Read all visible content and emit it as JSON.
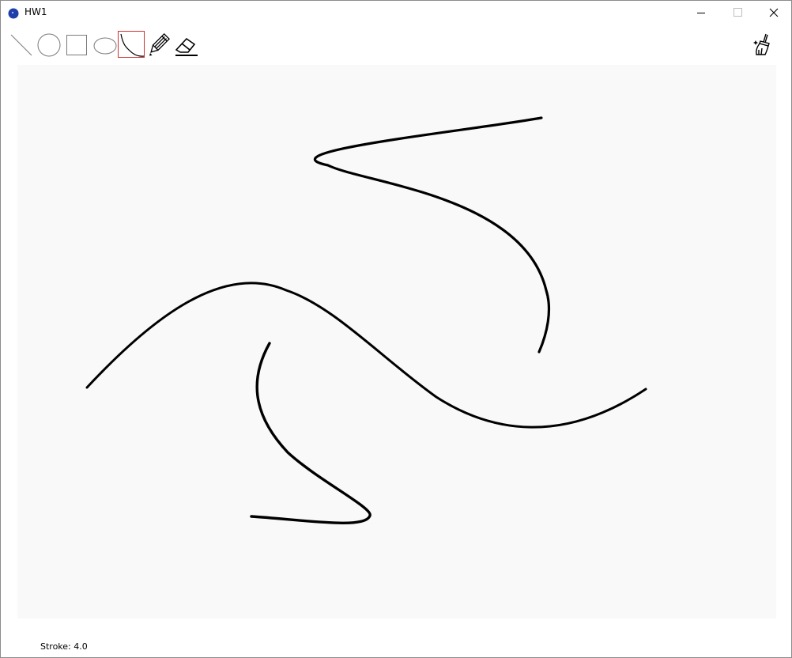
{
  "window": {
    "title": "HW1"
  },
  "toolbar": {
    "tools": [
      {
        "name": "line-tool",
        "icon": "line-icon",
        "selected": false
      },
      {
        "name": "circle-tool",
        "icon": "circle-icon",
        "selected": false
      },
      {
        "name": "rectangle-tool",
        "icon": "rectangle-icon",
        "selected": false
      },
      {
        "name": "ellipse-tool",
        "icon": "ellipse-icon",
        "selected": false
      },
      {
        "name": "curve-tool",
        "icon": "curve-icon",
        "selected": true
      },
      {
        "name": "pencil-tool",
        "icon": "pencil-icon",
        "selected": false
      },
      {
        "name": "eraser-tool",
        "icon": "eraser-icon",
        "selected": false
      }
    ],
    "clear_tool": {
      "icon": "broom-icon"
    }
  },
  "colors": {
    "canvas_background": "#f9f9f9",
    "stroke": "#000000",
    "selected_border": "#cc3333",
    "app_icon": "#1e3fa8"
  },
  "status": {
    "stroke_label": "Stroke: 4.0"
  }
}
